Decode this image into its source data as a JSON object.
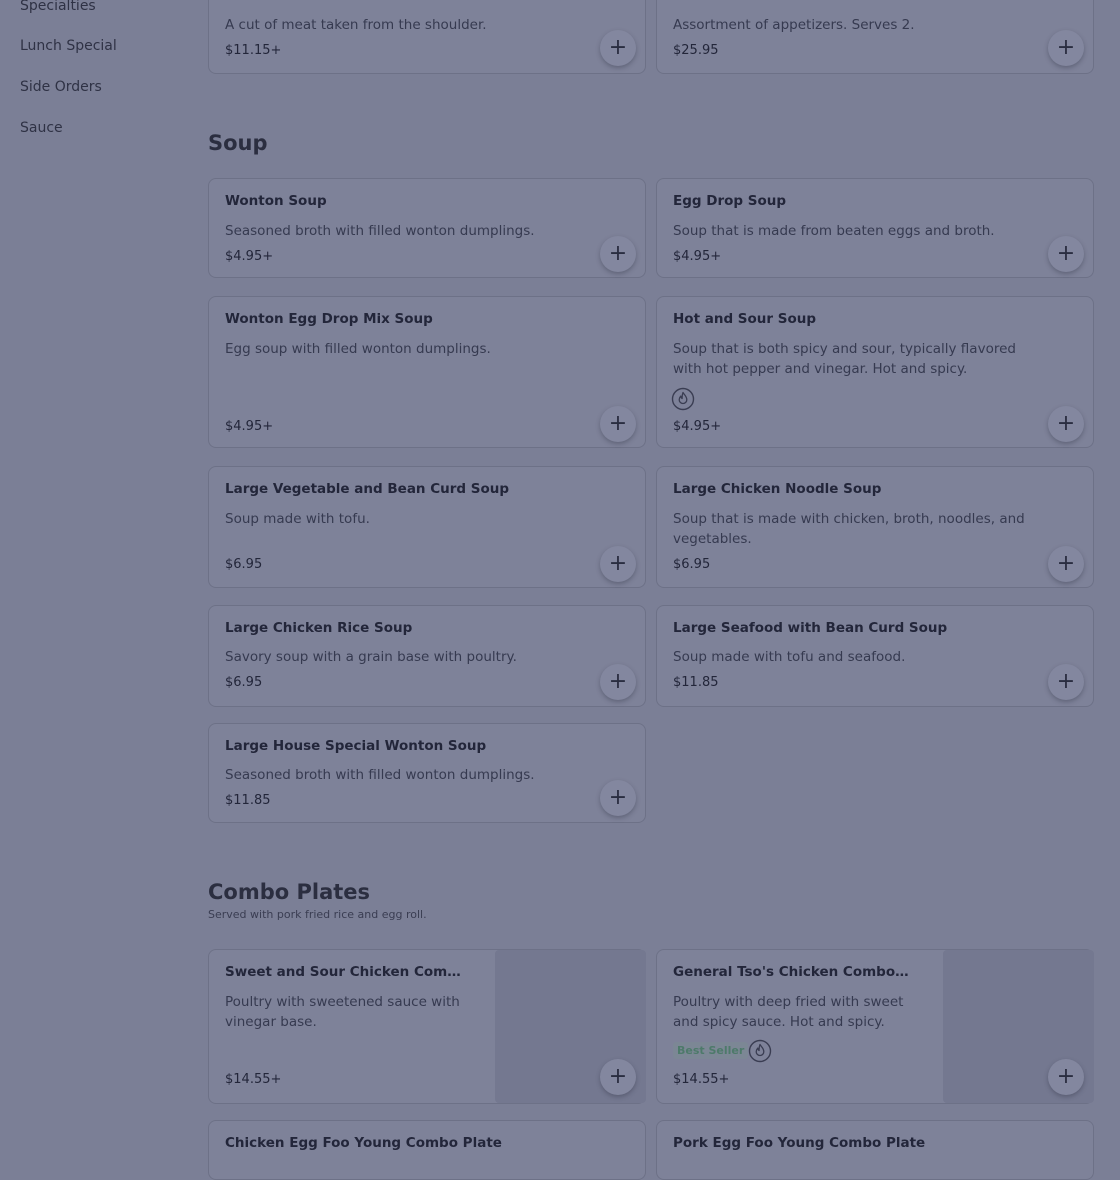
{
  "sidebar": {
    "items": [
      {
        "label": "Specialties"
      },
      {
        "label": "Lunch Special"
      },
      {
        "label": "Side Orders"
      },
      {
        "label": "Sauce"
      }
    ]
  },
  "top_cards": [
    {
      "description": "A cut of meat taken from the shoulder.",
      "price": "$11.15+"
    },
    {
      "description": "Assortment of appetizers. Serves 2.",
      "price": "$25.95"
    }
  ],
  "soup": {
    "title": "Soup",
    "items": [
      {
        "name": "Wonton Soup",
        "description": "Seasoned broth with filled wonton dumplings.",
        "price": "$4.95+"
      },
      {
        "name": "Egg Drop Soup",
        "description": "Soup that is made from beaten eggs and broth.",
        "price": "$4.95+"
      },
      {
        "name": "Wonton Egg Drop Mix Soup",
        "description": "Egg soup with filled wonton dumplings.",
        "price": "$4.95+"
      },
      {
        "name": "Hot and Sour Soup",
        "description": "Soup that is both spicy and sour, typically flavored with hot pepper and vinegar. Hot and spicy.",
        "price": "$4.95+"
      },
      {
        "name": "Large Vegetable and Bean Curd Soup",
        "description": "Soup made with tofu.",
        "price": "$6.95"
      },
      {
        "name": "Large Chicken Noodle Soup",
        "description": "Soup that is made with chicken, broth, noodles, and vegetables.",
        "price": "$6.95"
      },
      {
        "name": "Large Chicken Rice Soup",
        "description": "Savory soup with a grain base with poultry.",
        "price": "$6.95"
      },
      {
        "name": "Large Seafood with Bean Curd Soup",
        "description": "Soup made with tofu and seafood.",
        "price": "$11.85"
      },
      {
        "name": "Large House Special Wonton Soup",
        "description": "Seasoned broth with filled wonton dumplings.",
        "price": "$11.85"
      }
    ]
  },
  "combo": {
    "title": "Combo Plates",
    "subtitle": "Served with pork fried rice and egg roll.",
    "items": [
      {
        "name": "Sweet and Sour Chicken Combo ...",
        "description": "Poultry with sweetened sauce with vinegar base.",
        "price": "$14.55+"
      },
      {
        "name": "General Tso's Chicken Combo ...",
        "description": "Poultry with deep fried with sweet and spicy sauce. Hot and spicy.",
        "price": "$14.55+",
        "badge": "Best Seller"
      },
      {
        "name": "Chicken Egg Foo Young Combo Plate"
      },
      {
        "name": "Pork Egg Foo Young Combo Plate"
      }
    ]
  },
  "icons": {
    "add": "+",
    "spicy": "flame-icon"
  }
}
